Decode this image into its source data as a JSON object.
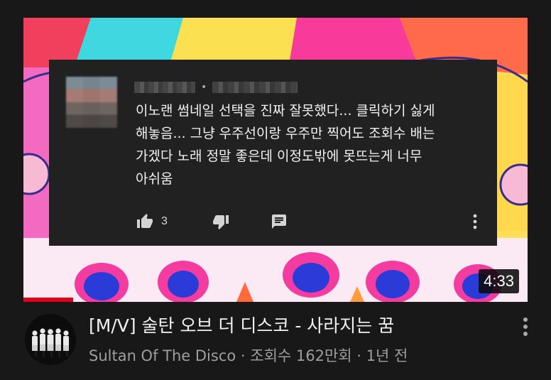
{
  "thumbnail": {
    "duration": "4:33",
    "watched_fraction": 0.1
  },
  "comment": {
    "author_name": "",
    "timestamp": "",
    "text": "이노랜 썸네일 선택을 진짜 잘못했다... 클릭하기 싫게\n해놓음... 그냥 우주선이랑 우주만 찍어도 조회수 배는\n가겠다 노래 정말 좋은데 이정도밖에 못뜨는게 너무\n아쉬움",
    "like_count": "3",
    "icons": {
      "like": "thumbs-up-icon",
      "dislike": "thumbs-down-icon",
      "reply": "comment-reply-icon",
      "more": "more-vertical-icon"
    }
  },
  "video": {
    "title": "[M/V] 술탄 오브 더 디스코 - 사라지는 꿈",
    "meta": "Sultan Of The Disco · 조회수 162만회 · 1년 전",
    "channel": "Sultan Of The Disco",
    "views": "조회수 162만회",
    "age": "1년 전"
  },
  "colors": {
    "background": "#181818",
    "overlay": "#212121",
    "text_primary": "#f1f1f1",
    "text_secondary": "#9e9e9e",
    "progress": "#e3001b"
  }
}
